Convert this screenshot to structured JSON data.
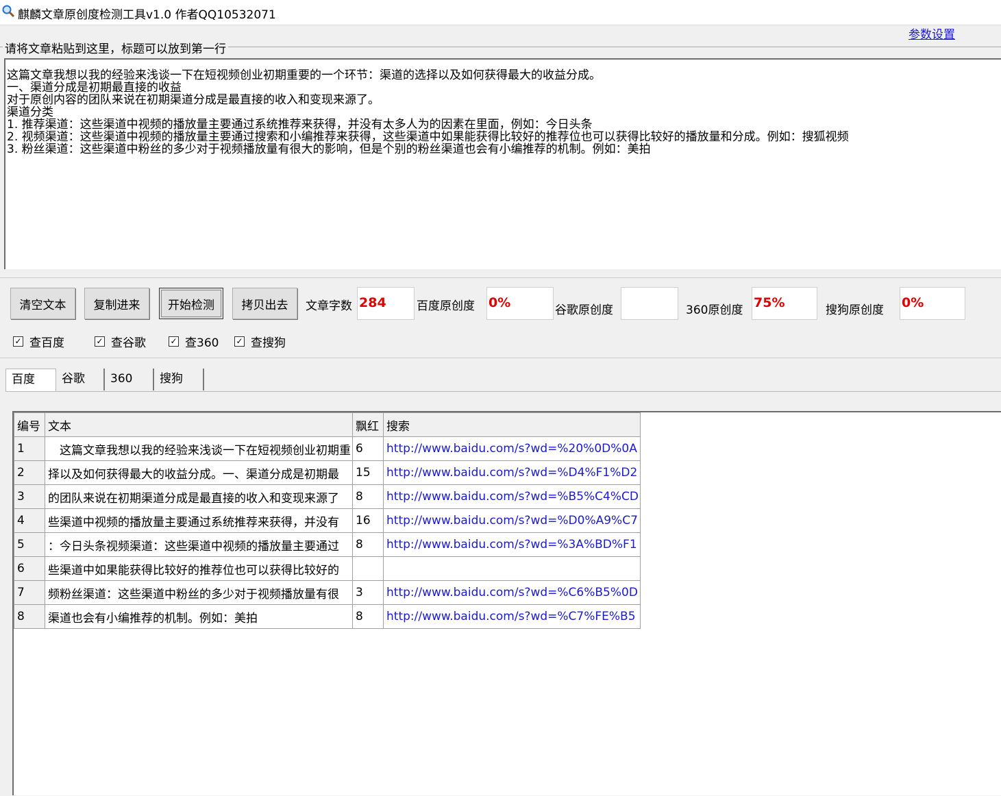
{
  "window": {
    "title": "麒麟文章原创度检测工具v1.0 作者QQ10532071",
    "icon": "magnifier-icon"
  },
  "settings_link": "参数设置",
  "article_group": {
    "title": "请将文章粘贴到这里，标题可以放到第一行",
    "content": "这篇文章我想以我的经验来浅谈一下在短视频创业初期重要的一个环节：渠道的选择以及如何获得最大的收益分成。\n一、渠道分成是初期最直接的收益\n对于原创内容的团队来说在初期渠道分成是最直接的收入和变现来源了。\n渠道分类\n1. 推荐渠道：这些渠道中视频的播放量主要通过系统推荐来获得，并没有太多人为的因素在里面，例如：今日头条\n2. 视频渠道：这些渠道中视频的播放量主要通过搜索和小编推荐来获得，这些渠道中如果能获得比较好的推荐位也可以获得比较好的播放量和分成。例如：搜狐视频\n3. 粉丝渠道：这些渠道中粉丝的多少对于视频播放量有很大的影响，但是个别的粉丝渠道也会有小编推荐的机制。例如：美拍"
  },
  "buttons": {
    "clear": "清空文本",
    "paste": "复制进来",
    "start": "开始检测",
    "copy_out": "拷贝出去"
  },
  "stats": {
    "word_count_label": "文章字数",
    "word_count": "284",
    "baidu_label": "百度原创度",
    "baidu_value": "0%",
    "google_label": "谷歌原创度",
    "google_value": "",
    "s360_label": "360原创度",
    "s360_value": "75%",
    "sogou_label": "搜狗原创度",
    "sogou_value": "0%"
  },
  "checkboxes": {
    "baidu": {
      "label": "查百度",
      "checked": true
    },
    "google": {
      "label": "查谷歌",
      "checked": true
    },
    "s360": {
      "label": "查360",
      "checked": true
    },
    "sogou": {
      "label": "查搜狗",
      "checked": true
    }
  },
  "tabs": [
    "百度",
    "谷歌",
    "360",
    "搜狗"
  ],
  "results": {
    "columns": [
      "编号",
      "文本",
      "飘红",
      "搜索"
    ],
    "rows": [
      {
        "id": "1",
        "text": "　这篇文章我想以我的经验来浅谈一下在短视频创业初期重",
        "red": "6",
        "url": "http://www.baidu.com/s?wd=%20%0D%0A"
      },
      {
        "id": "2",
        "text": "择以及如何获得最大的收益分成。一、渠道分成是初期最",
        "red": "15",
        "url": "http://www.baidu.com/s?wd=%D4%F1%D2"
      },
      {
        "id": "3",
        "text": "的团队来说在初期渠道分成是最直接的收入和变现来源了",
        "red": "8",
        "url": "http://www.baidu.com/s?wd=%B5%C4%CD"
      },
      {
        "id": "4",
        "text": "些渠道中视频的播放量主要通过系统推荐来获得，并没有",
        "red": "16",
        "url": "http://www.baidu.com/s?wd=%D0%A9%C7"
      },
      {
        "id": "5",
        "text": "：今日头条视频渠道：这些渠道中视频的播放量主要通过",
        "red": "8",
        "url": "http://www.baidu.com/s?wd=%3A%BD%F1"
      },
      {
        "id": "6",
        "text": "些渠道中如果能获得比较好的推荐位也可以获得比较好的",
        "red": "",
        "url": ""
      },
      {
        "id": "7",
        "text": "频粉丝渠道：这些渠道中粉丝的多少对于视频播放量有很",
        "red": "3",
        "url": "http://www.baidu.com/s?wd=%C6%B5%0D"
      },
      {
        "id": "8",
        "text": "渠道也会有小编推荐的机制。例如：美拍",
        "red": "8",
        "url": "http://www.baidu.com/s?wd=%C7%FE%B5"
      }
    ]
  },
  "colors": {
    "accent_red": "#e00000",
    "link_blue": "#1a1ad6",
    "window_bg": "#f0f0f0"
  }
}
